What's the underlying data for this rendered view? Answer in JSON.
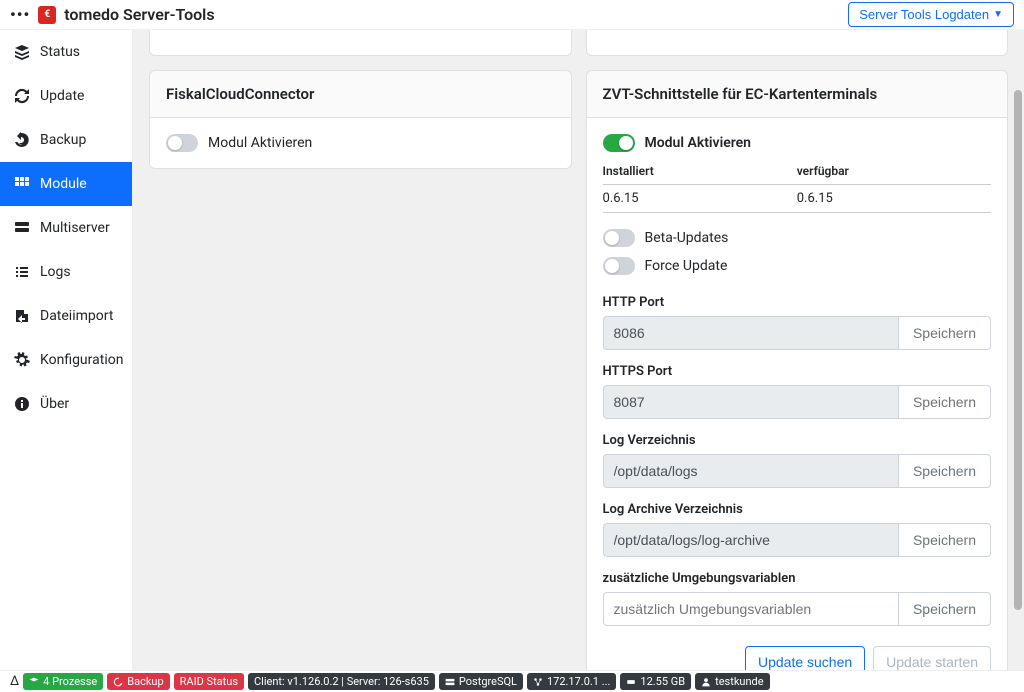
{
  "header": {
    "app_title": "tomedo Server-Tools",
    "log_button": "Server Tools Logdaten"
  },
  "sidebar": {
    "items": [
      {
        "label": "Status",
        "icon": "layers"
      },
      {
        "label": "Update",
        "icon": "sync"
      },
      {
        "label": "Backup",
        "icon": "undo"
      },
      {
        "label": "Module",
        "icon": "grid"
      },
      {
        "label": "Multiserver",
        "icon": "server"
      },
      {
        "label": "Logs",
        "icon": "list"
      },
      {
        "label": "Dateiimport",
        "icon": "import"
      },
      {
        "label": "Konfiguration",
        "icon": "gear"
      },
      {
        "label": "Über",
        "icon": "info"
      }
    ]
  },
  "fiskal": {
    "title": "FiskalCloudConnector",
    "activate_label": "Modul Aktivieren"
  },
  "zvt": {
    "title": "ZVT-Schnittstelle für EC-Kartenterminals",
    "activate_label": "Modul Aktivieren",
    "installed_hdr": "Installiert",
    "available_hdr": "verfügbar",
    "installed_val": "0.6.15",
    "available_val": "0.6.15",
    "beta_label": "Beta-Updates",
    "force_label": "Force Update",
    "fields": {
      "http_port": {
        "label": "HTTP Port",
        "value": "8086"
      },
      "https_port": {
        "label": "HTTPS Port",
        "value": "8087"
      },
      "log_dir": {
        "label": "Log Verzeichnis",
        "value": "/opt/data/logs"
      },
      "archive_dir": {
        "label": "Log Archive Verzeichnis",
        "value": "/opt/data/logs/log-archive"
      },
      "env": {
        "label": "zusätzliche Umgebungsvariablen",
        "placeholder": "zusätzlich Umgebungsvariablen"
      }
    },
    "save_label": "Speichern",
    "search_label": "Update suchen",
    "start_label": "Update starten"
  },
  "statusbar": {
    "processes": "4 Prozesse",
    "backup": "Backup",
    "raid": "RAID Status",
    "client": "Client: v1.126.0.2 | Server: 126-s635",
    "db": "PostgreSQL",
    "ip": "172.17.0.1 ...",
    "disk": "12.55 GB",
    "user": "testkunde"
  }
}
